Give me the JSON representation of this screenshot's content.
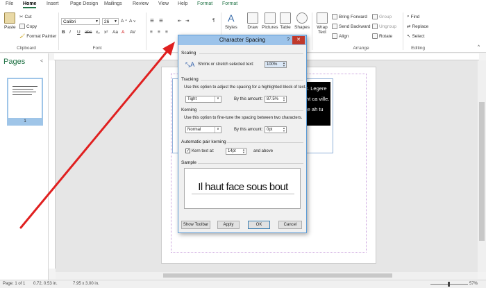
{
  "ribbon": {
    "tabs": [
      {
        "label": "File"
      },
      {
        "label": "Home"
      },
      {
        "label": "Insert"
      },
      {
        "label": "Page Design"
      },
      {
        "label": "Mailings"
      },
      {
        "label": "Review"
      },
      {
        "label": "View"
      },
      {
        "label": "Help"
      },
      {
        "label": "Format"
      },
      {
        "label": "Format"
      }
    ],
    "clipboard": {
      "paste": "Paste",
      "cut": "Cut",
      "copy": "Copy",
      "format_painter": "Format Painter",
      "label": "Clipboard"
    },
    "font": {
      "name": "Calibri",
      "size": "26",
      "label": "Font"
    },
    "objects": {
      "styles": "Styles",
      "draw": "Draw",
      "pictures": "Pictures",
      "table": "Table",
      "shapes": "Shapes"
    },
    "arrange": {
      "wrap_text": "Wrap Text",
      "bring_forward": "Bring Forward",
      "send_backward": "Send Backward",
      "align": "Align",
      "group": "Group",
      "ungroup": "Ungroup",
      "rotate": "Rotate",
      "label": "Arrange"
    },
    "editing": {
      "find": "Find",
      "replace": "Replace",
      "select": "Select",
      "label": "Editing"
    }
  },
  "pages_pane": {
    "title": "Pages",
    "page_number": "1"
  },
  "document": {
    "lines": [
      "t. Legere",
      "ht ca ville.",
      "je ah tu"
    ]
  },
  "dialog": {
    "title": "Character Spacing",
    "help": "?",
    "close": "✕",
    "scaling": {
      "heading": "Scaling",
      "label": "Shrink or stretch selected text:",
      "value": "100%"
    },
    "tracking": {
      "heading": "Tracking",
      "description": "Use this option to adjust the spacing for a highlighted block of text.",
      "selected": "Tight",
      "amount_label": "By this amount:",
      "amount": "87.5%"
    },
    "kerning": {
      "heading": "Kerning",
      "description": "Use this option to fine-tune the spacing between two characters.",
      "selected": "Normal",
      "amount_label": "By this amount:",
      "amount": "0pt"
    },
    "pair_kerning": {
      "heading": "Automatic pair kerning",
      "checkbox_label": "Kern text at:",
      "checked": "✓",
      "value": "14pt",
      "suffix": "and above"
    },
    "sample": {
      "heading": "Sample",
      "text": "Il haut face sous bout"
    },
    "buttons": {
      "show_toolbar": "Show Toolbar",
      "apply": "Apply",
      "ok": "OK",
      "cancel": "Cancel"
    }
  },
  "status_bar": {
    "page": "Page: 1 of 1",
    "position": "0.72, 0.53 in.",
    "size": "7.95 x 3.00 in.",
    "zoom": "57%"
  },
  "colors": {
    "accent": "#217346",
    "arrow": "#e02020",
    "dialog_title": "#9cc3ea"
  }
}
